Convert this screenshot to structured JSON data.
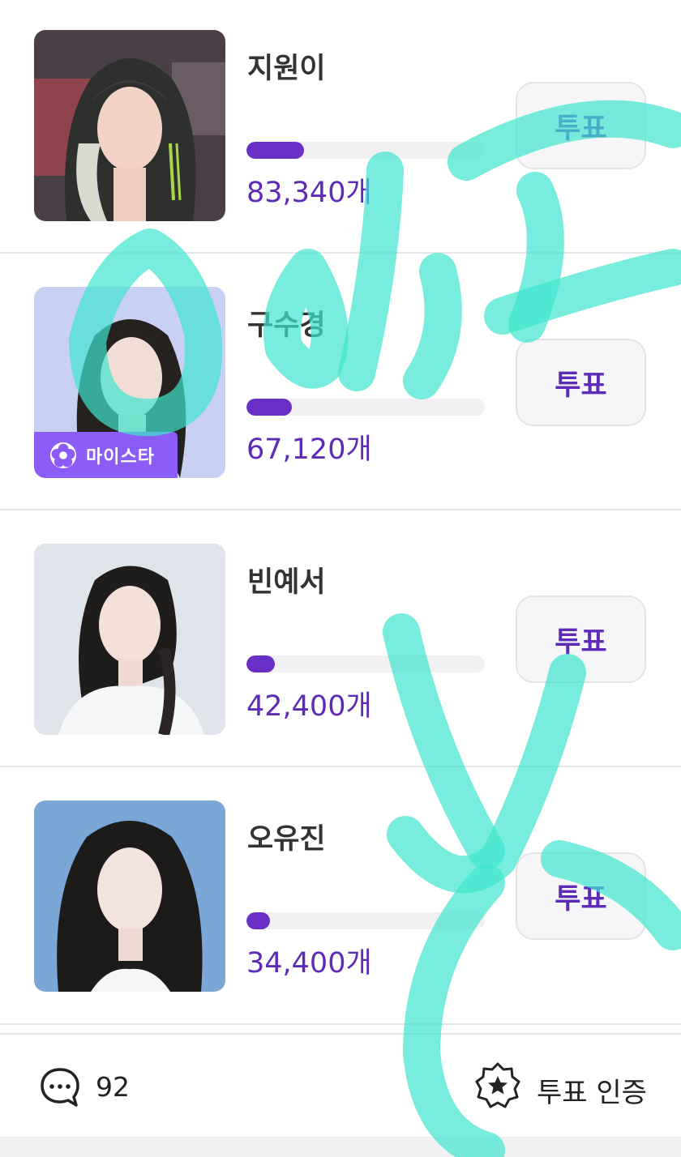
{
  "candidates": [
    {
      "name": "지원이",
      "count": "83,340개",
      "vote_label": "투표",
      "progress": 0.24
    },
    {
      "name": "구수경",
      "count": "67,120개",
      "vote_label": "투표",
      "progress": 0.19,
      "badge": "마이스타"
    },
    {
      "name": "빈예서",
      "count": "42,400개",
      "vote_label": "투표",
      "progress": 0.12
    },
    {
      "name": "오유진",
      "count": "34,400개",
      "vote_label": "투표",
      "progress": 0.1
    }
  ],
  "footer": {
    "comment_count": "92",
    "verify_label": "투표 인증"
  },
  "colors": {
    "accent": "#5e2bb8",
    "bar_fill": "#6a2fc4",
    "badge": "#8b5cf6",
    "overlay_scribble": "#3ee6cf"
  },
  "icons": {
    "comment": "comment-bubble-icon",
    "verify": "star-badge-icon",
    "badge": "flower-icon"
  }
}
